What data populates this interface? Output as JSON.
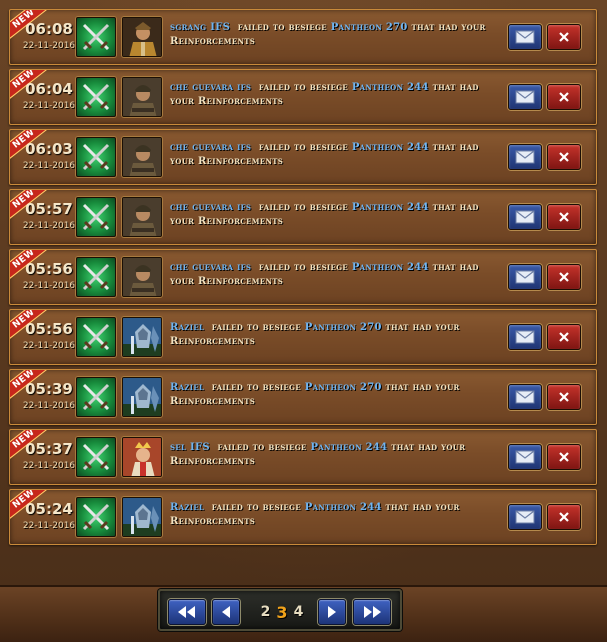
{
  "reports": [
    {
      "badge": "NEW",
      "time": "06:08",
      "date": "22-11-2016",
      "player": "sgrang IFS",
      "action": "failed to besiege",
      "target": "Pantheon 270",
      "suffix": "that had your Reinforcements",
      "hero_icon": "warlord-portrait-icon"
    },
    {
      "badge": "NEW",
      "time": "06:04",
      "date": "22-11-2016",
      "player": "che guevara ifs",
      "action": "failed to besiege",
      "target": "Pantheon 244",
      "suffix": "that had your Reinforcements",
      "hero_icon": "soldier-portrait-icon"
    },
    {
      "badge": "NEW",
      "time": "06:03",
      "date": "22-11-2016",
      "player": "che guevara ifs",
      "action": "failed to besiege",
      "target": "Pantheon 244",
      "suffix": "that had your Reinforcements",
      "hero_icon": "soldier-portrait-icon"
    },
    {
      "badge": "NEW",
      "time": "05:57",
      "date": "22-11-2016",
      "player": "che guevara ifs",
      "action": "failed to besiege",
      "target": "Pantheon 244",
      "suffix": "that had your Reinforcements",
      "hero_icon": "soldier-portrait-icon"
    },
    {
      "badge": "NEW",
      "time": "05:56",
      "date": "22-11-2016",
      "player": "che guevara ifs",
      "action": "failed to besiege",
      "target": "Pantheon 244",
      "suffix": "that had your Reinforcements",
      "hero_icon": "soldier-portrait-icon"
    },
    {
      "badge": "NEW",
      "time": "05:56",
      "date": "22-11-2016",
      "player": "Raziel",
      "action": "failed to besiege",
      "target": "Pantheon 270",
      "suffix": "that had your Reinforcements",
      "hero_icon": "knight-portrait-icon"
    },
    {
      "badge": "NEW",
      "time": "05:39",
      "date": "22-11-2016",
      "player": "Raziel",
      "action": "failed to besiege",
      "target": "Pantheon 270",
      "suffix": "that had your Reinforcements",
      "hero_icon": "knight-portrait-icon"
    },
    {
      "badge": "NEW",
      "time": "05:37",
      "date": "22-11-2016",
      "player": "sel IFS",
      "action": "failed to besiege",
      "target": "Pantheon 244",
      "suffix": "that had your Reinforcements",
      "hero_icon": "king-portrait-icon"
    },
    {
      "badge": "NEW",
      "time": "05:24",
      "date": "22-11-2016",
      "player": "Raziel",
      "action": "failed to besiege",
      "target": "Pantheon 244",
      "suffix": "that had your Reinforcements",
      "hero_icon": "knight-portrait-icon"
    }
  ],
  "pagination": {
    "pages": [
      "2",
      "3",
      "4"
    ],
    "current": "3"
  },
  "colors": {
    "player_link": "#6fb5f2",
    "message_text": "#f3e3c0",
    "badge_red": "#c7271b",
    "current_page": "#f0a21a",
    "mail_button": "#2b468f",
    "delete_button": "#a3231d"
  }
}
